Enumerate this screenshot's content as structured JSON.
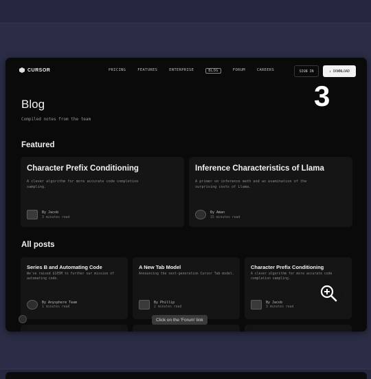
{
  "nav": {
    "brand": "CURSOR",
    "links": [
      "PRICING",
      "FEATURES",
      "ENTERPRISE",
      "BLOG",
      "FORUM",
      "CAREERS"
    ],
    "sign_in": "SIGN IN",
    "download": "DOWNLOAD"
  },
  "step_number": "3",
  "page": {
    "title": "Blog",
    "subtitle": "Compiled notes from the team"
  },
  "featured": {
    "heading": "Featured",
    "cards": [
      {
        "title": "Character Prefix Conditioning",
        "desc": "A clever algorithm for more accurate code completion sampling.",
        "author": "By Jacob",
        "read_time": "3 minutes read"
      },
      {
        "title": "Inference Characteristics of Llama",
        "desc": "A primer on inference math and an examination of the surprising costs of Llama.",
        "author": "By Aman",
        "read_time": "15 minutes read"
      }
    ]
  },
  "all_posts": {
    "heading": "All posts",
    "cards": [
      {
        "title": "Series B and Automating Code",
        "desc": "We've raised $105M to further our mission of automating code.",
        "author": "By Anysphere Team",
        "read_time": "1 minutes read"
      },
      {
        "title": "A New Tab Model",
        "desc": "Announcing the next-generation Cursor Tab model.",
        "author": "By Phillip",
        "read_time": "2 minutes read"
      },
      {
        "title": "Character Prefix Conditioning",
        "desc": "A clever algorithm for more accurate code completion sampling.",
        "author": "By Jacob",
        "read_time": "3 minutes read"
      }
    ]
  },
  "tooltip": "Click on the 'Forum' link",
  "icons": {
    "zoom": "zoom-in-icon",
    "logo": "cursor-logo-icon"
  },
  "colors": {
    "page_bg": "#2a2d45",
    "frame_bg": "#0a0a0a",
    "card_bg": "#151515",
    "accent_text": "#f2f2f2"
  }
}
